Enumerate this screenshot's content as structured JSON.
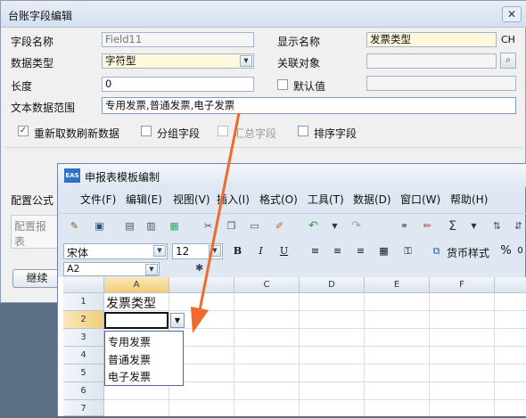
{
  "dialog": {
    "title": "台账字段编辑",
    "close_label": "✕",
    "field_name_label": "字段名称",
    "field_name_value": "Field11",
    "display_name_label": "显示名称",
    "display_name_value": "发票类型",
    "display_name_suffix": "CH",
    "data_type_label": "数据类型",
    "data_type_value": "字符型",
    "related_object_label": "关联对象",
    "length_label": "长度",
    "length_value": "0",
    "default_label": "默认值",
    "text_range_label": "文本数据范围",
    "text_range_value": "专用发票,普通发票,电子发票",
    "checkboxes": [
      {
        "label": "重新取数刷新数据",
        "checked": true
      },
      {
        "label": "分组字段",
        "checked": false
      },
      {
        "label": "汇总字段",
        "checked": false
      },
      {
        "label": "排序字段",
        "checked": false
      }
    ],
    "config_formula_label": "配置公式",
    "config_report_placeholder": "配置报表",
    "continue_button": "继续"
  },
  "sheet": {
    "title": "申报表模板编制",
    "logo": "EAS",
    "menus": [
      "文件(F)",
      "编辑(E)",
      "视图(V)",
      "插入(I)",
      "格式(O)",
      "工具(T)",
      "数据(D)",
      "窗口(W)",
      "帮助(H)"
    ],
    "font_name": "宋体",
    "font_size": "12",
    "currency_style": "货币样式",
    "cell_ref": "A2",
    "columns": [
      "A",
      "B",
      "C",
      "D",
      "E",
      "F"
    ],
    "rows": [
      "1",
      "2",
      "3",
      "4",
      "5",
      "6",
      "7"
    ],
    "a1_value": "发票类型",
    "dropdown_options": [
      "专用发票",
      "普通发票",
      "电子发票"
    ]
  },
  "colors": {
    "accent_orange": "#f06a2a",
    "title_gradient": "#dfe7f2"
  }
}
